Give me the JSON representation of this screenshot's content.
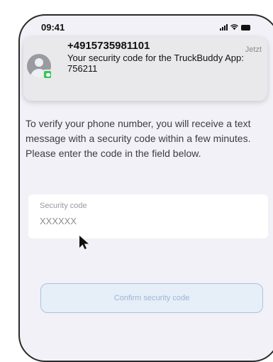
{
  "status_bar": {
    "time": "09:41",
    "icons": [
      "cellular-signal-icon",
      "wifi-icon",
      "battery-icon"
    ]
  },
  "notification": {
    "sender": "+4915735981101",
    "time": "Jetzt",
    "message": "Your security code for the TruckBuddy App: 756211",
    "avatar_icon": "contact-avatar-icon",
    "badge_icon": "messages-app-icon",
    "badge_color": "#34c759"
  },
  "main": {
    "instructions": "To verify your phone number, you will receive a text message with a security code within a few minutes. Please enter the code in the field below.",
    "security_field": {
      "label": "Security code",
      "placeholder": "XXXXXX"
    },
    "confirm_button": {
      "label": "Confirm security code",
      "border_color": "#a9c3e3"
    }
  },
  "pointer_icon": "mouse-cursor-icon"
}
